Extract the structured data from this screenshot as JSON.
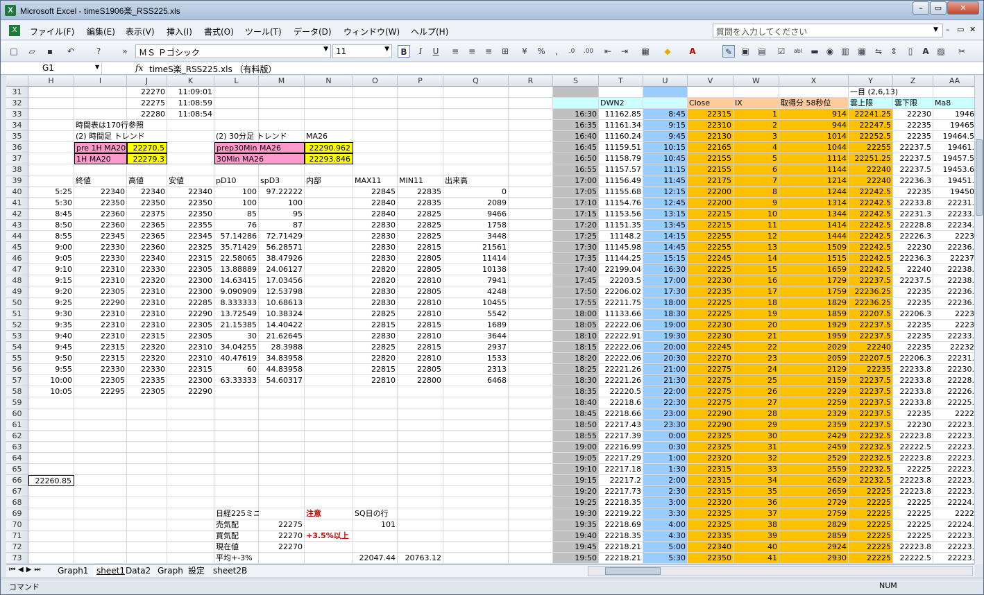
{
  "window": {
    "title": "Microsoft Excel - timeS1906楽_RSS225.xls",
    "icon": "excel-icon"
  },
  "menu": [
    "ファイル(F)",
    "編集(E)",
    "表示(V)",
    "挿入(I)",
    "書式(O)",
    "ツール(T)",
    "データ(D)",
    "ウィンドウ(W)",
    "ヘルプ(H)"
  ],
  "help_placeholder": "質問を入力してください",
  "toolbar": {
    "font_name": "ＭＳ Ｐゴシック",
    "font_size": "11"
  },
  "formula_bar": {
    "name_box": "G1",
    "fx": "fx",
    "formula": "timeS楽_RSS225.xls （有料版）"
  },
  "columns": [
    "H",
    "I",
    "J",
    "K",
    "L",
    "M",
    "N",
    "O",
    "P",
    "Q",
    "R",
    "S",
    "T",
    "U",
    "V",
    "W",
    "X",
    "Y",
    "Z",
    "AA"
  ],
  "rows": [
    "31",
    "32",
    "33",
    "34",
    "35",
    "36",
    "37",
    "38",
    "39",
    "40",
    "41",
    "42",
    "43",
    "44",
    "45",
    "46",
    "47",
    "48",
    "49",
    "50",
    "51",
    "52",
    "53",
    "54",
    "55",
    "56",
    "57",
    "58",
    "59",
    "60",
    "61",
    "62",
    "63",
    "64",
    "65",
    "66",
    "67",
    "68",
    "69",
    "70",
    "71",
    "72",
    "73"
  ],
  "left": {
    "r31": {
      "J": "22270",
      "K": "11:09:01"
    },
    "r32": {
      "J": "22275",
      "K": "11:08:59"
    },
    "r33": {
      "J": "22280",
      "K": "11:08:54"
    },
    "note34": "時間表は170行参照",
    "hdr35a": "(2) 時間足 トレンド",
    "hdr35b": "(2) 30分足 トレンド",
    "ma26": "MA26",
    "pre1h": "pre 1H MA20",
    "pre1h_val": "22270.5",
    "h1": "1H MA20",
    "h1_val": "22279.3",
    "prep30": "prep30Min MA26",
    "prep30_val": "22290.962",
    "m30": "30Min MA26",
    "m30_val": "22293.846",
    "headers": [
      "終値",
      "高値",
      "安値",
      "pD10",
      "spD3",
      "内部",
      "MAX11",
      "MIN11",
      "出来高"
    ],
    "data": [
      [
        "5:25",
        "22340",
        "22340",
        "22340",
        "100",
        "97.22222",
        "",
        "22845",
        "22835",
        "0"
      ],
      [
        "5:30",
        "22350",
        "22350",
        "22350",
        "100",
        "100",
        "",
        "22840",
        "22835",
        "2089"
      ],
      [
        "8:45",
        "22360",
        "22375",
        "22350",
        "85",
        "95",
        "",
        "22840",
        "22825",
        "9466"
      ],
      [
        "8:50",
        "22360",
        "22365",
        "22355",
        "76",
        "87",
        "",
        "22830",
        "22825",
        "1758"
      ],
      [
        "8:55",
        "22345",
        "22365",
        "22345",
        "57.14286",
        "72.71429",
        "",
        "22830",
        "22825",
        "3448"
      ],
      [
        "9:00",
        "22330",
        "22360",
        "22325",
        "35.71429",
        "56.28571",
        "",
        "22830",
        "22815",
        "21561"
      ],
      [
        "9:05",
        "22330",
        "22340",
        "22315",
        "22.58065",
        "38.47926",
        "",
        "22830",
        "22805",
        "11414"
      ],
      [
        "9:10",
        "22310",
        "22330",
        "22305",
        "13.88889",
        "24.06127",
        "",
        "22820",
        "22805",
        "10138"
      ],
      [
        "9:15",
        "22310",
        "22320",
        "22300",
        "14.63415",
        "17.03456",
        "",
        "22820",
        "22810",
        "7941"
      ],
      [
        "9:20",
        "22305",
        "22310",
        "22300",
        "9.090909",
        "12.53798",
        "",
        "22830",
        "22805",
        "4248"
      ],
      [
        "9:25",
        "22290",
        "22310",
        "22285",
        "8.333333",
        "10.68613",
        "",
        "22830",
        "22810",
        "10455"
      ],
      [
        "9:30",
        "22310",
        "22310",
        "22290",
        "13.72549",
        "10.38324",
        "",
        "22825",
        "22810",
        "5542"
      ],
      [
        "9:35",
        "22310",
        "22310",
        "22305",
        "21.15385",
        "14.40422",
        "",
        "22815",
        "22815",
        "1689"
      ],
      [
        "9:40",
        "22310",
        "22315",
        "22305",
        "30",
        "21.62645",
        "",
        "22830",
        "22810",
        "3644"
      ],
      [
        "9:45",
        "22315",
        "22320",
        "22310",
        "34.04255",
        "28.3988",
        "",
        "22825",
        "22815",
        "2937"
      ],
      [
        "9:50",
        "22315",
        "22320",
        "22310",
        "40.47619",
        "34.83958",
        "",
        "22820",
        "22810",
        "1533"
      ],
      [
        "9:55",
        "22330",
        "22330",
        "22315",
        "60",
        "44.83958",
        "",
        "22815",
        "22805",
        "2313"
      ],
      [
        "10:00",
        "22305",
        "22335",
        "22300",
        "63.33333",
        "54.60317",
        "",
        "22810",
        "22800",
        "6468"
      ],
      [
        "10:05",
        "22295",
        "22305",
        "22290",
        "",
        "",
        "",
        "",
        "",
        ""
      ]
    ],
    "h66": "22260.85",
    "nk": "日経225ミニ",
    "caution": "注意",
    "sq": "SQ日の行",
    "sell": "売気配",
    "sell_val": "22275",
    "sq_val": "101",
    "buy": "買気配",
    "buy_val": "22270",
    "pct": "+3.5%以上",
    "cur": "現在値",
    "cur_val": "22270",
    "avg": "平均+-3%",
    "avg_o": "22047.44",
    "avg_p": "20763.12"
  },
  "right": {
    "y31": "一目 (2,6,13)",
    "hdr_t": "DWN2",
    "hdr_v": "Close",
    "hdr_w": "IX",
    "hdr_x": "取得分 58秒位",
    "hdr_y": "雲上限",
    "hdr_z": "雲下限",
    "hdr_aa": "Ma8",
    "data": [
      [
        "16:30",
        "11162.85",
        "8:45",
        "22315",
        "1",
        "914",
        "22241.25",
        "22230",
        "1946"
      ],
      [
        "16:35",
        "11161.34",
        "9:15",
        "22310",
        "2",
        "944",
        "22247.5",
        "22235",
        "19465"
      ],
      [
        "16:40",
        "11160.24",
        "9:45",
        "22130",
        "3",
        "1014",
        "22252.5",
        "22235",
        "19464.5"
      ],
      [
        "16:45",
        "11159.51",
        "10:15",
        "22165",
        "4",
        "1044",
        "22255",
        "22237.5",
        "19461."
      ],
      [
        "16:50",
        "11158.79",
        "10:45",
        "22155",
        "5",
        "1114",
        "22251.25",
        "22237.5",
        "19457.5"
      ],
      [
        "16:55",
        "11157.57",
        "11:15",
        "22155",
        "6",
        "1144",
        "22240",
        "22237.5",
        "19453.6"
      ],
      [
        "17:00",
        "11156.49",
        "11:45",
        "22175",
        "7",
        "1214",
        "22240",
        "22236.3",
        "19451."
      ],
      [
        "17:05",
        "11155.68",
        "12:15",
        "22200",
        "8",
        "1244",
        "22242.5",
        "22235",
        "19450"
      ],
      [
        "17:10",
        "11154.76",
        "12:45",
        "22200",
        "9",
        "1314",
        "22242.5",
        "22233.8",
        "22231."
      ],
      [
        "17:15",
        "11153.56",
        "13:15",
        "22215",
        "10",
        "1344",
        "22242.5",
        "22231.3",
        "22233."
      ],
      [
        "17:20",
        "11151.35",
        "13:45",
        "22215",
        "11",
        "1414",
        "22242.5",
        "22228.8",
        "22234."
      ],
      [
        "17:25",
        "11148.2",
        "14:15",
        "22255",
        "12",
        "1444",
        "22242.5",
        "22226.3",
        "2223"
      ],
      [
        "17:30",
        "11145.98",
        "14:45",
        "22255",
        "13",
        "1509",
        "22242.5",
        "22230",
        "22236."
      ],
      [
        "17:35",
        "11144.25",
        "15:15",
        "22245",
        "14",
        "1515",
        "22242.5",
        "22236.3",
        "22237"
      ],
      [
        "17:40",
        "22199.04",
        "16:30",
        "22225",
        "15",
        "1659",
        "22242.5",
        "22240",
        "22238."
      ],
      [
        "17:45",
        "22203.5",
        "17:00",
        "22230",
        "16",
        "1729",
        "22237.5",
        "22237.5",
        "22238."
      ],
      [
        "17:50",
        "22206.02",
        "17:30",
        "22235",
        "17",
        "1759",
        "22236.25",
        "22235",
        "22236."
      ],
      [
        "17:55",
        "22211.75",
        "18:00",
        "22225",
        "18",
        "1829",
        "22236.25",
        "22235",
        "22236."
      ],
      [
        "18:00",
        "11133.66",
        "18:30",
        "22225",
        "19",
        "1859",
        "22207.5",
        "22206.3",
        "2223"
      ],
      [
        "18:05",
        "22222.06",
        "19:00",
        "22230",
        "20",
        "1929",
        "22237.5",
        "22235",
        "2223"
      ],
      [
        "18:10",
        "22222.91",
        "19:30",
        "22230",
        "21",
        "1959",
        "22237.5",
        "22235",
        "22233."
      ],
      [
        "18:15",
        "22222.06",
        "20:00",
        "22245",
        "22",
        "2029",
        "22240",
        "22235",
        "22232"
      ],
      [
        "18:20",
        "22222.06",
        "20:30",
        "22270",
        "23",
        "2059",
        "22207.5",
        "22206.3",
        "22231."
      ],
      [
        "18:25",
        "22221.26",
        "21:00",
        "22275",
        "24",
        "2129",
        "22235",
        "22233.8",
        "22230."
      ],
      [
        "18:30",
        "22221.26",
        "21:30",
        "22275",
        "25",
        "2159",
        "22237.5",
        "22233.8",
        "22228."
      ],
      [
        "18:35",
        "22220.5",
        "22:00",
        "22275",
        "26",
        "2229",
        "22237.5",
        "22233.8",
        "22226."
      ],
      [
        "18:40",
        "22218.6",
        "22:30",
        "22275",
        "27",
        "2259",
        "22237.5",
        "22233.8",
        "22225."
      ],
      [
        "18:45",
        "22218.66",
        "23:00",
        "22290",
        "28",
        "2329",
        "22237.5",
        "22235",
        "2222"
      ],
      [
        "18:50",
        "22217.43",
        "23:30",
        "22290",
        "29",
        "2359",
        "22237.5",
        "22230",
        "22223."
      ],
      [
        "18:55",
        "22217.39",
        "0:00",
        "22325",
        "30",
        "2429",
        "22232.5",
        "22223.8",
        "22223."
      ],
      [
        "19:00",
        "22216.99",
        "0:30",
        "22325",
        "31",
        "2459",
        "22232.5",
        "22222.5",
        "22223."
      ],
      [
        "19:05",
        "22217.29",
        "1:00",
        "22320",
        "32",
        "2529",
        "22232.5",
        "22223.8",
        "22223."
      ],
      [
        "19:10",
        "22217.18",
        "1:30",
        "22315",
        "33",
        "2559",
        "22232.5",
        "22225",
        "22223."
      ],
      [
        "19:15",
        "22217.2",
        "2:00",
        "22315",
        "34",
        "2629",
        "22232.5",
        "22223.8",
        "22223."
      ],
      [
        "19:20",
        "22217.73",
        "2:30",
        "22315",
        "35",
        "2659",
        "22225",
        "22223.8",
        "22223."
      ],
      [
        "19:25",
        "22218.35",
        "3:00",
        "22320",
        "36",
        "2729",
        "22225",
        "22225",
        "22224."
      ],
      [
        "19:30",
        "22219.22",
        "3:30",
        "22325",
        "37",
        "2759",
        "22225",
        "22225",
        "2222"
      ],
      [
        "19:35",
        "22218.69",
        "4:00",
        "22325",
        "38",
        "2829",
        "22225",
        "22225",
        "22224."
      ],
      [
        "19:40",
        "22218.35",
        "4:30",
        "22335",
        "39",
        "2859",
        "22225",
        "22225",
        "22223."
      ],
      [
        "19:45",
        "22218.21",
        "5:00",
        "22340",
        "40",
        "2924",
        "22225",
        "22223.8",
        "22223."
      ],
      [
        "19:50",
        "22218.21",
        "5:30",
        "22350",
        "41",
        "2930",
        "22225",
        "22222.5",
        "22223."
      ]
    ]
  },
  "sheet_tabs": [
    "Graph1",
    "sheet1",
    "Data2",
    "Graph",
    "設定",
    "sheet2B"
  ],
  "active_tab": "sheet1",
  "status": {
    "left": "コマンド",
    "num": "NUM"
  }
}
